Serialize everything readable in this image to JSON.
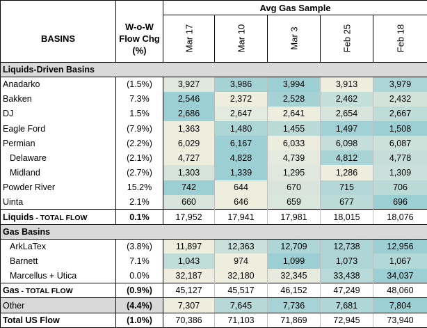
{
  "header": {
    "avg_label": "Avg Gas Sample",
    "basins_label": "BASINS",
    "wow_label": "W-o-W Flow Chg (%)",
    "dates": [
      "Mar 17",
      "Mar 10",
      "Mar 3",
      "Feb 25",
      "Feb 18"
    ]
  },
  "colors": {
    "section_gray": "#d9d9d9",
    "heat_low": "#fdf3e1",
    "heat_high": "#9ccfd4"
  },
  "rows": [
    {
      "kind": "section",
      "name": "Liquids-Driven Basins"
    },
    {
      "kind": "data",
      "name": "Anadarko",
      "wow": "(1.5%)",
      "values": [
        "3,927",
        "3,986",
        "3,994",
        "3,913",
        "3,979"
      ]
    },
    {
      "kind": "data",
      "name": "Bakken",
      "wow": "7.3%",
      "values": [
        "2,546",
        "2,372",
        "2,528",
        "2,462",
        "2,432"
      ]
    },
    {
      "kind": "data",
      "name": "DJ",
      "wow": "1.5%",
      "values": [
        "2,686",
        "2,647",
        "2,641",
        "2,654",
        "2,667"
      ]
    },
    {
      "kind": "data",
      "name": "Eagle Ford",
      "wow": "(7.9%)",
      "values": [
        "1,363",
        "1,480",
        "1,455",
        "1,497",
        "1,508"
      ]
    },
    {
      "kind": "data",
      "name": "Permian",
      "wow": "(2.2%)",
      "values": [
        "6,029",
        "6,167",
        "6,033",
        "6,098",
        "6,087"
      ]
    },
    {
      "kind": "data",
      "name": "Delaware",
      "indent": true,
      "wow": "(2.1%)",
      "values": [
        "4,727",
        "4,828",
        "4,739",
        "4,812",
        "4,778"
      ]
    },
    {
      "kind": "data",
      "name": "Midland",
      "indent": true,
      "wow": "(2.7%)",
      "values": [
        "1,303",
        "1,339",
        "1,295",
        "1,286",
        "1,309"
      ]
    },
    {
      "kind": "data",
      "name": "Powder River",
      "wow": "15.2%",
      "values": [
        "742",
        "644",
        "670",
        "715",
        "706"
      ]
    },
    {
      "kind": "data",
      "name": "Uinta",
      "wow": "2.1%",
      "values": [
        "660",
        "646",
        "659",
        "677",
        "696"
      ]
    },
    {
      "kind": "total",
      "name_bold": "Liquids",
      "name_small": " - TOTAL FLOW",
      "wow": "0.1%",
      "values": [
        "17,952",
        "17,941",
        "17,981",
        "18,015",
        "18,076"
      ]
    },
    {
      "kind": "section",
      "name": "Gas Basins"
    },
    {
      "kind": "data",
      "name": "ArkLaTex",
      "indent": true,
      "wow": "(3.8%)",
      "values": [
        "11,897",
        "12,363",
        "12,709",
        "12,738",
        "12,956"
      ]
    },
    {
      "kind": "data",
      "name": "Barnett",
      "indent": true,
      "wow": "7.1%",
      "values": [
        "1,043",
        "974",
        "1,099",
        "1,073",
        "1,067"
      ]
    },
    {
      "kind": "data",
      "name": "Marcellus + Utica",
      "indent": true,
      "wow": "0.0%",
      "values": [
        "32,187",
        "32,180",
        "32,345",
        "33,438",
        "34,037"
      ]
    },
    {
      "kind": "total",
      "name_bold": "Gas",
      "name_small": " - TOTAL FLOW",
      "wow": "(0.9%)",
      "values": [
        "45,127",
        "45,517",
        "46,152",
        "47,249",
        "48,060"
      ]
    },
    {
      "kind": "other",
      "name": "Other",
      "wow": "(4.4%)",
      "values": [
        "7,307",
        "7,645",
        "7,736",
        "7,681",
        "7,804"
      ]
    },
    {
      "kind": "grand",
      "name": "Total US Flow",
      "wow": "(1.0%)",
      "values": [
        "70,386",
        "71,103",
        "71,869",
        "72,945",
        "73,940"
      ]
    }
  ]
}
